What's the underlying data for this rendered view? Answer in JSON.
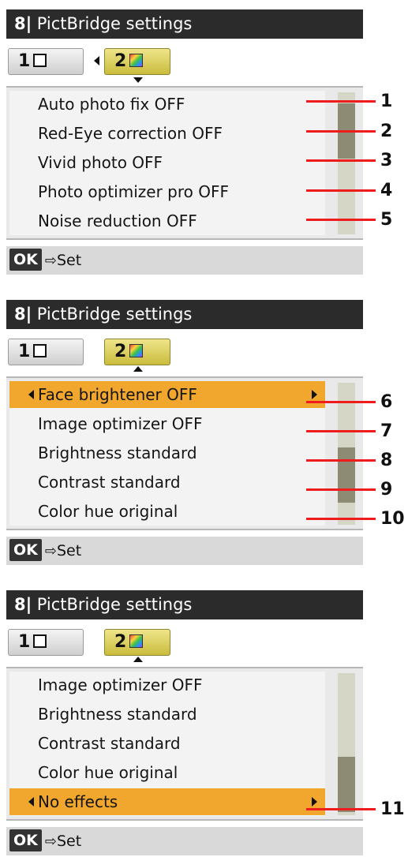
{
  "title": "PictBridge settings",
  "tabs": {
    "tab1_label": "1",
    "tab2_label": "2"
  },
  "footer": {
    "ok_label": "OK",
    "set_label": "Set",
    "arrow": "⇨"
  },
  "screens": [
    {
      "items": [
        "Auto photo fix OFF",
        "Red-Eye correction OFF",
        "Vivid photo OFF",
        "Photo optimizer pro OFF",
        "Noise reduction OFF"
      ],
      "callouts": [
        "1",
        "2",
        "3",
        "4",
        "5"
      ]
    },
    {
      "items": [
        "Face brightener OFF",
        "Image optimizer OFF",
        "Brightness standard",
        "Contrast standard",
        "Color hue original"
      ],
      "callouts": [
        "6",
        "7",
        "8",
        "9",
        "10"
      ]
    },
    {
      "items": [
        "Image optimizer OFF",
        "Brightness standard",
        "Contrast standard",
        "Color hue original",
        "No effects"
      ],
      "callouts": [
        "11"
      ]
    }
  ],
  "colors": {
    "title_bg": "#2b2b2b",
    "selected_item": "#f1a62d",
    "active_tab": "#e0d45e",
    "callout_line": "#ee1c1c"
  }
}
